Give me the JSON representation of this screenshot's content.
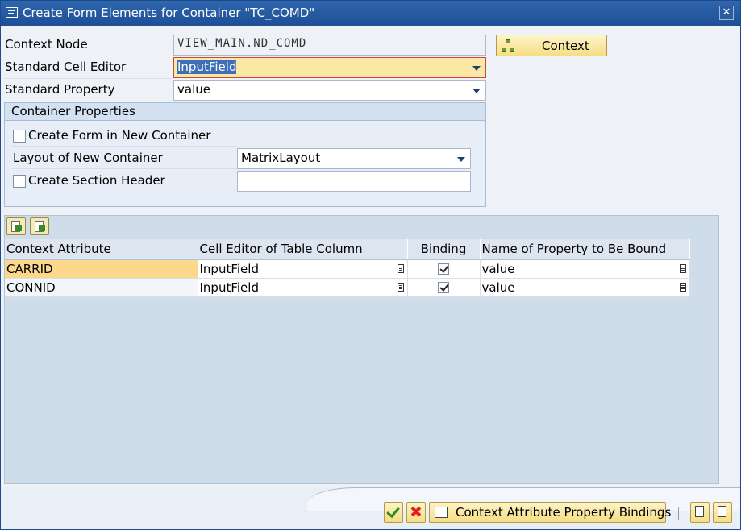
{
  "window": {
    "title": "Create Form Elements for Container \"TC_COMD\"",
    "close_icon": "close-icon"
  },
  "form": {
    "context_node_label": "Context Node",
    "context_node_value": "VIEW_MAIN.ND_COMD",
    "context_button_label": "Context",
    "standard_cell_editor_label": "Standard Cell Editor",
    "standard_cell_editor_value": "InputField",
    "standard_property_label": "Standard Property",
    "standard_property_value": "value"
  },
  "container_properties": {
    "title": "Container Properties",
    "create_form_label": "Create Form in New Container",
    "layout_label": "Layout of New Container",
    "layout_value": "MatrixLayout",
    "section_header_label": "Create Section Header",
    "section_header_value": ""
  },
  "table": {
    "columns": [
      "Context Attribute",
      "Cell Editor of Table Column",
      "Binding",
      "Name of Property to Be Bound"
    ],
    "rows": [
      {
        "attribute": "CARRID",
        "editor": "InputField",
        "binding": true,
        "property": "value"
      },
      {
        "attribute": "CONNID",
        "editor": "InputField",
        "binding": true,
        "property": "value"
      }
    ]
  },
  "footer": {
    "bindings_button_label": "Context Attribute Property Bindings"
  },
  "colors": {
    "title_bar": "#1d4f96",
    "button_yellow": "#f6de84",
    "selected_row": "#fbd88b"
  }
}
